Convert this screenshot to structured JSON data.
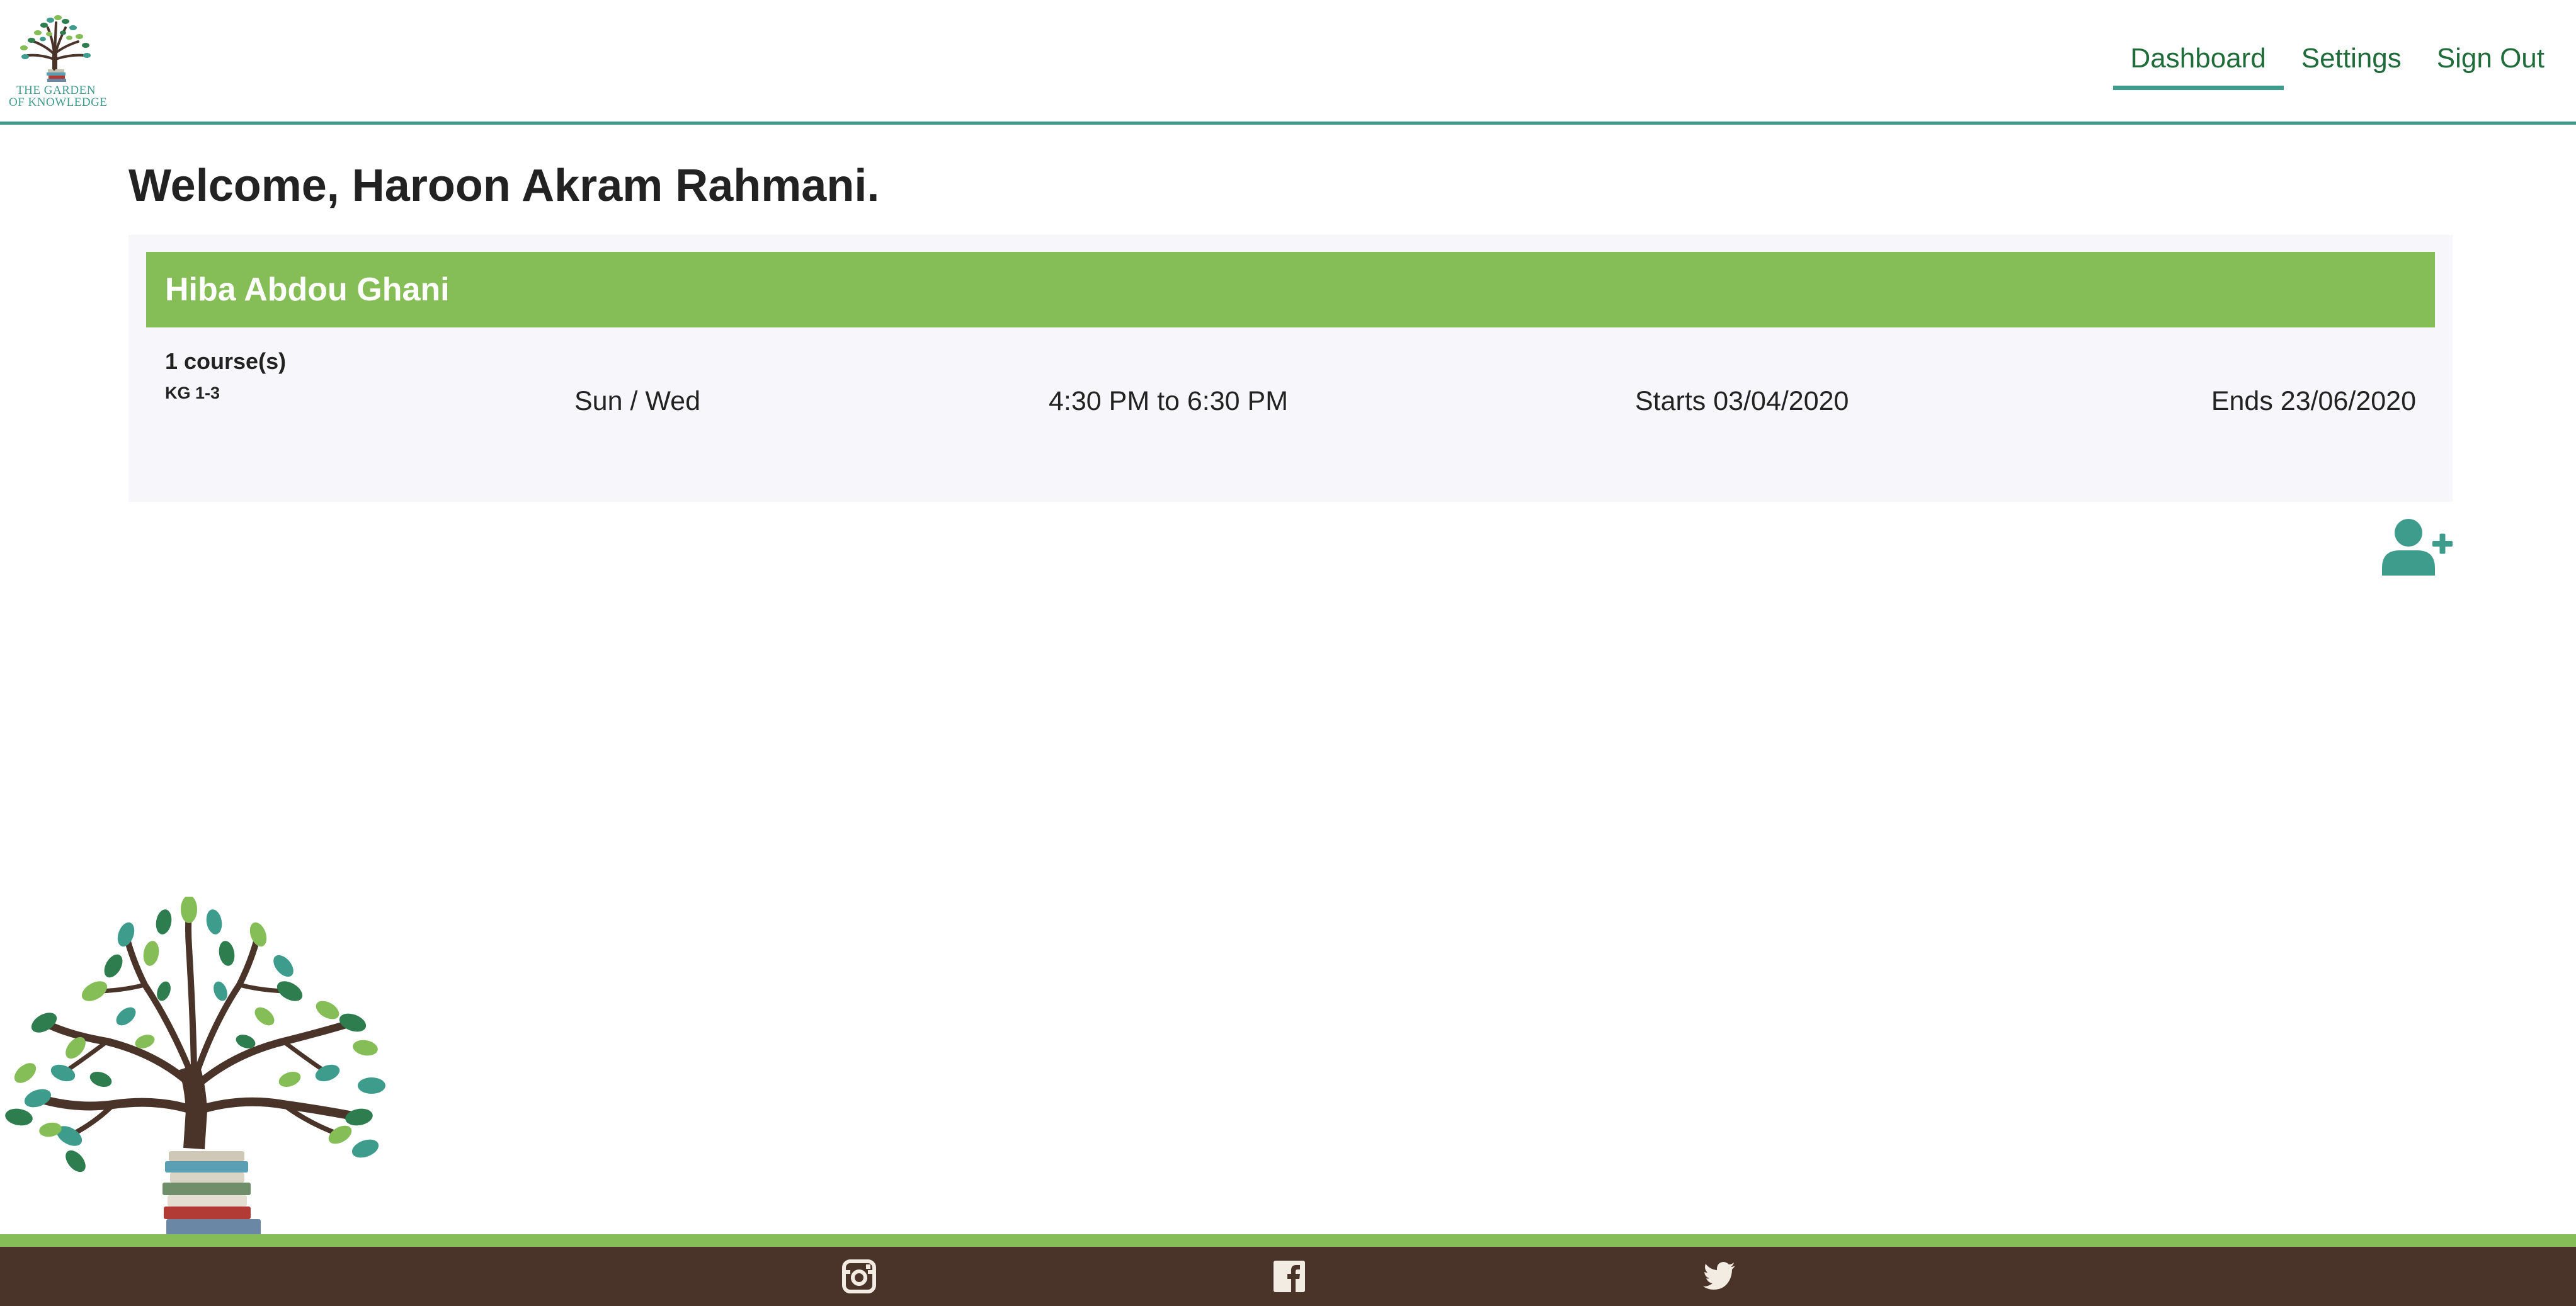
{
  "brand": {
    "line1": "THE GARDEN",
    "line2": "OF KNOWLEDGE",
    "logo_icon": "tree-with-books-logo"
  },
  "nav": {
    "items": [
      {
        "label": "Dashboard",
        "active": true
      },
      {
        "label": "Settings",
        "active": false
      },
      {
        "label": "Sign Out",
        "active": false
      }
    ]
  },
  "main": {
    "welcome": "Welcome, Haroon Akram Rahmani.",
    "students": [
      {
        "name": "Hiba Abdou Ghani",
        "course_count": "1 course(s)",
        "courses": [
          {
            "level": "KG 1-3",
            "days": "Sun / Wed",
            "time": "4:30 PM to 6:30 PM",
            "starts": "Starts 03/04/2020",
            "ends": "Ends 23/06/2020"
          }
        ]
      }
    ],
    "add_student_icon": "user-plus-icon"
  },
  "footer": {
    "icons": [
      "instagram-icon",
      "facebook-icon",
      "twitter-icon"
    ]
  },
  "colors": {
    "accent_teal": "#3e9c8c",
    "nav_green": "#1f6b3a",
    "student_bar_green": "#85bd57",
    "footer_brown": "#4a3429",
    "panel_bg": "#f7f7fb"
  }
}
